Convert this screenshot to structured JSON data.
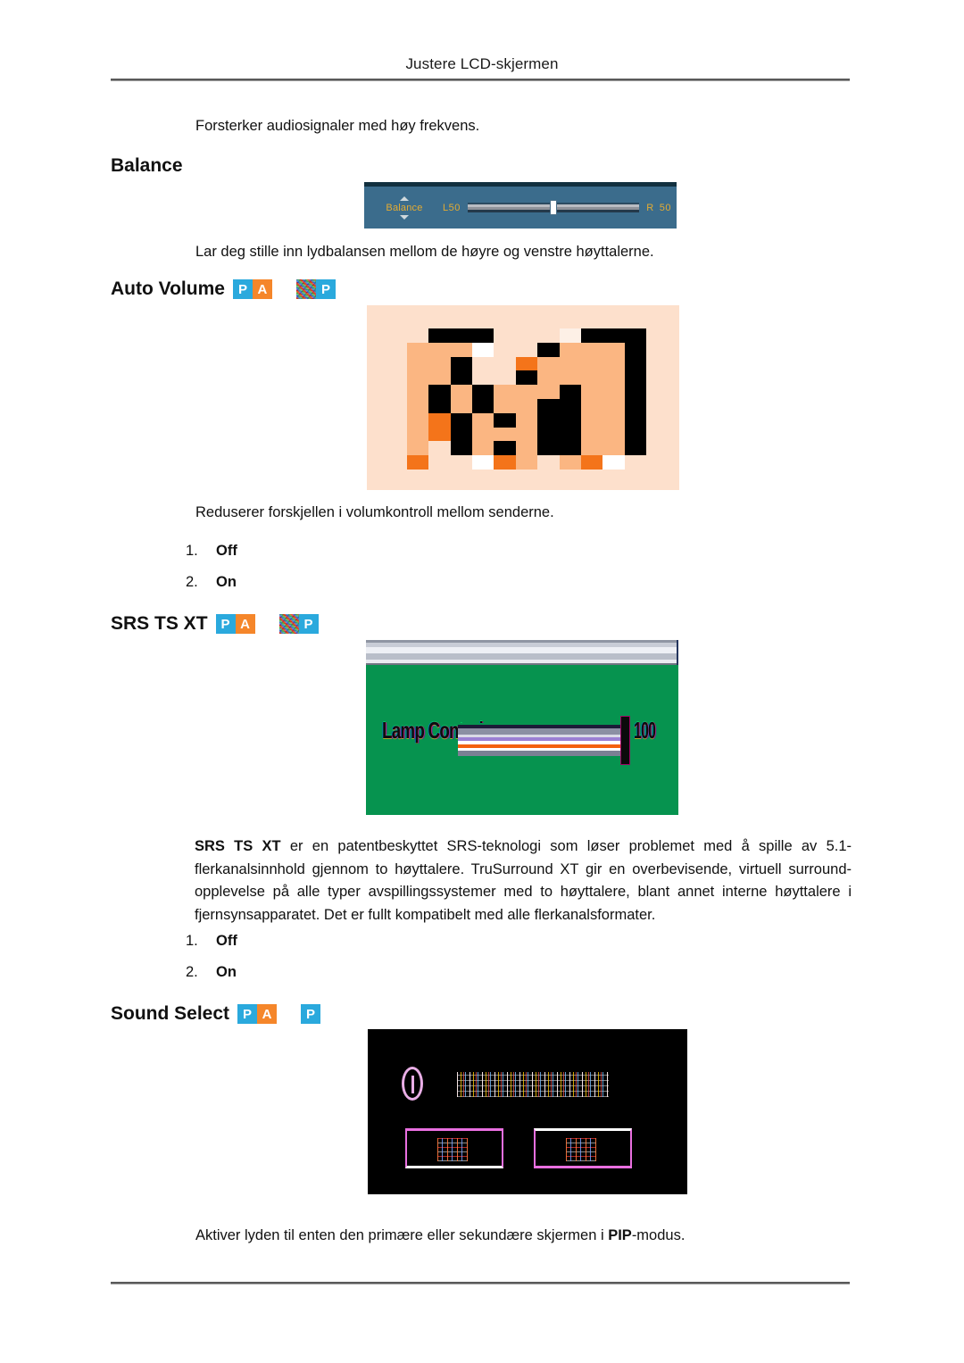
{
  "document": {
    "header_title": "Justere LCD-skjermen",
    "intro_line": "Forsterker audiosignaler med høy frekvens."
  },
  "sections": {
    "balance": {
      "heading": "Balance",
      "description": "Lar deg stille inn lydbalansen mellom de høyre og venstre høyttalerne.",
      "osd": {
        "label": "Balance",
        "left_label": "L",
        "left_value": "50",
        "right_label": "R",
        "right_value": "50",
        "panel_color": "#3b6c8c",
        "text_color": "#e3ab33",
        "slider_percent": 50
      }
    },
    "auto_volume": {
      "heading": "Auto Volume",
      "badges": [
        "P",
        "A",
        "noise",
        "P"
      ],
      "description": "Reduserer forskjellen i volumkontroll mellom senderne.",
      "options": [
        {
          "num": "1.",
          "label": "Off"
        },
        {
          "num": "2.",
          "label": "On"
        }
      ]
    },
    "srs_ts_xt": {
      "heading": "SRS TS XT",
      "badges": [
        "P",
        "A",
        "noise",
        "P"
      ],
      "osd": {
        "label": "Lamp Control",
        "value": "100",
        "background_color": "#06934f"
      },
      "paragraph_bold": "SRS TS XT",
      "paragraph_rest": " er en patentbeskyttet SRS-teknologi som løser problemet med å spille av 5.1-flerkanalsinnhold gjennom to høyttalere. TruSurround XT gir en overbevisende, virtuell surround-opplevelse på alle typer avspillingssystemer med to høyttalere, blant annet interne høyttalere i fjernsynsapparatet. Det er fullt kompatibelt med alle flerkanalsformater.",
      "options": [
        {
          "num": "1.",
          "label": "Off"
        },
        {
          "num": "2.",
          "label": "On"
        }
      ]
    },
    "sound_select": {
      "heading": "Sound Select",
      "badges": [
        "P",
        "A",
        "P"
      ],
      "description_prefix": "Aktiver lyden til enten den primære eller sekundære skjermen i ",
      "description_bold": "PIP",
      "description_suffix": "-modus."
    }
  },
  "colors": {
    "badge_blue": "#2aa9dd",
    "badge_orange": "#f5862a",
    "osd_blue": "#3b6c8c",
    "osd_gold": "#e3ab33",
    "osd_green": "#06934f",
    "pix_peach_light": "#fde0cc",
    "pix_peach": "#fbb682",
    "pix_orange": "#f4741a",
    "pix_black": "#000000",
    "pix_white": "#ffffff"
  },
  "pixel_image": {
    "description": "corrupted pixelated block image resembling letter M",
    "rows": [
      [
        "pl",
        "k",
        "k",
        "k",
        "pl",
        "pl",
        "pl",
        "w2",
        "k",
        "k",
        "k"
      ],
      [
        "p",
        "p",
        "p",
        "w",
        "pl",
        "pl",
        "k",
        "p",
        "p",
        "p",
        "k"
      ],
      [
        "p",
        "p",
        "k",
        "pl",
        "pl",
        "o",
        "p",
        "p",
        "p",
        "p",
        "k"
      ],
      [
        "p",
        "p",
        "k",
        "pl",
        "pl",
        "k",
        "p",
        "p",
        "p",
        "p",
        "k"
      ],
      [
        "p",
        "k",
        "p",
        "k",
        "p",
        "p",
        "p",
        "k",
        "p",
        "p",
        "k"
      ],
      [
        "p",
        "k",
        "p",
        "k",
        "p",
        "p",
        "k",
        "k",
        "p",
        "p",
        "k"
      ],
      [
        "p",
        "o",
        "k",
        "p",
        "k",
        "p",
        "k",
        "k",
        "p",
        "p",
        "k"
      ],
      [
        "p",
        "o",
        "k",
        "p",
        "p",
        "p",
        "k",
        "k",
        "p",
        "p",
        "k"
      ],
      [
        "p",
        "pl",
        "k",
        "p",
        "k",
        "p",
        "k",
        "k",
        "p",
        "p",
        "k"
      ],
      [
        "o",
        "pl",
        "pl",
        "w",
        "o",
        "p",
        "pl",
        "p",
        "o",
        "w",
        "pl"
      ]
    ]
  }
}
